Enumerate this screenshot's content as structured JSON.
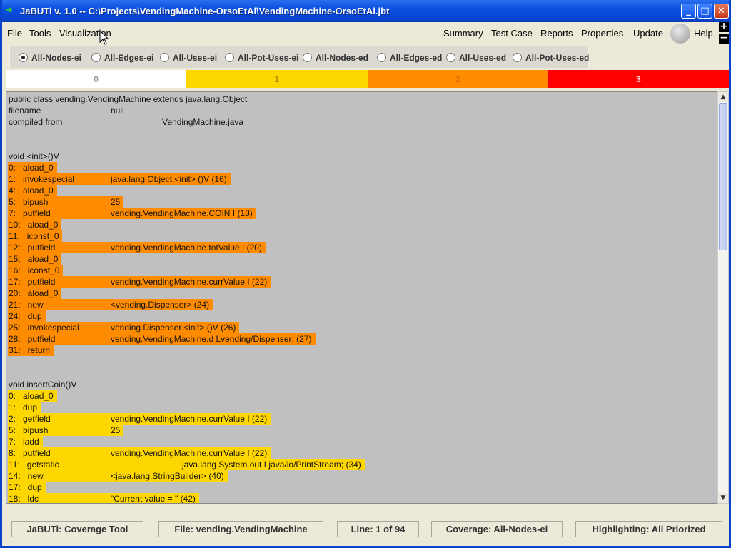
{
  "window": {
    "title": "JaBUTi v. 1.0 -- C:\\Projects\\VendingMachine-OrsoEtAl\\VendingMachine-OrsoEtAl.jbt",
    "minimize": "_",
    "maximize": "□",
    "close": "✕"
  },
  "menu": {
    "file": "File",
    "tools": "Tools",
    "visualization": "Visualization",
    "summary": "Summary",
    "test_case": "Test Case",
    "reports": "Reports",
    "properties": "Properties",
    "update": "Update",
    "help": "Help",
    "zoom_in": "+",
    "zoom_out": "−"
  },
  "criteria": [
    {
      "label": "All-Nodes-ei",
      "selected": true
    },
    {
      "label": "All-Edges-ei",
      "selected": false
    },
    {
      "label": "All-Uses-ei",
      "selected": false
    },
    {
      "label": "All-Pot-Uses-ei",
      "selected": false
    },
    {
      "label": "All-Nodes-ed",
      "selected": false
    },
    {
      "label": "All-Edges-ed",
      "selected": false
    },
    {
      "label": "All-Uses-ed",
      "selected": false
    },
    {
      "label": "All-Pot-Uses-ed",
      "selected": false
    }
  ],
  "weights": [
    {
      "label": "0",
      "bg": "#ffffff",
      "fg": "#999999"
    },
    {
      "label": "1",
      "bg": "#ffd700",
      "fg": "#b09000"
    },
    {
      "label": "2",
      "bg": "#ff8c00",
      "fg": "#e07000"
    },
    {
      "label": "3",
      "bg": "#ff0000",
      "fg": "#ffd0d0"
    }
  ],
  "code": {
    "header": [
      {
        "col1": "public class vending.VendingMachine extends java.lang.Object",
        "col2": ""
      },
      {
        "col1": "filename",
        "col2": "null"
      },
      {
        "col1": "compiled from",
        "col2": "VendingMachine.java"
      }
    ],
    "methods": [
      {
        "signature": "void <init>()V",
        "color": "#ff8c00",
        "lines": [
          {
            "op": "0:   aload_0",
            "arg": ""
          },
          {
            "op": "1:   invokespecial",
            "arg": "java.lang.Object.<init> ()V (16)"
          },
          {
            "op": "4:   aload_0",
            "arg": ""
          },
          {
            "op": "5:   bipush",
            "arg": "25"
          },
          {
            "op": "7:   putfield",
            "arg": "vending.VendingMachine.COIN I (18)"
          },
          {
            "op": "10:   aload_0",
            "arg": ""
          },
          {
            "op": "11:   iconst_0",
            "arg": ""
          },
          {
            "op": "12:   putfield",
            "arg": "vending.VendingMachine.totValue I (20)"
          },
          {
            "op": "15:   aload_0",
            "arg": ""
          },
          {
            "op": "16:   iconst_0",
            "arg": ""
          },
          {
            "op": "17:   putfield",
            "arg": "vending.VendingMachine.currValue I (22)"
          },
          {
            "op": "20:   aload_0",
            "arg": ""
          },
          {
            "op": "21:   new",
            "arg": "<vending.Dispenser> (24)"
          },
          {
            "op": "24:   dup",
            "arg": ""
          },
          {
            "op": "25:   invokespecial",
            "arg": "vending.Dispenser.<init> ()V (26)"
          },
          {
            "op": "28:   putfield",
            "arg": "vending.VendingMachine.d Lvending/Dispenser; (27)"
          },
          {
            "op": "31:   return",
            "arg": ""
          }
        ]
      },
      {
        "signature": "void insertCoin()V",
        "color": "#ffd700",
        "lines": [
          {
            "op": "0:   aload_0",
            "arg": ""
          },
          {
            "op": "1:   dup",
            "arg": ""
          },
          {
            "op": "2:   getfield",
            "arg": "vending.VendingMachine.currValue I (22)"
          },
          {
            "op": "5:   bipush",
            "arg": "25"
          },
          {
            "op": "7:   iadd",
            "arg": ""
          },
          {
            "op": "8:   putfield",
            "arg": "vending.VendingMachine.currValue I (22)"
          },
          {
            "op": "11:   getstatic",
            "arg": "java.lang.System.out Ljava/io/PrintStream; (34)"
          },
          {
            "op": "14:   new",
            "arg": "<java.lang.StringBuilder> (40)"
          },
          {
            "op": "17:   dup",
            "arg": ""
          },
          {
            "op": "18:   ldc",
            "arg": "\"Current value = \" (42)"
          }
        ]
      }
    ]
  },
  "status": {
    "app": "JaBUTi: Coverage Tool",
    "file": "File: vending.VendingMachine",
    "line": "Line: 1 of 94",
    "coverage": "Coverage: All-Nodes-ei",
    "highlighting": "Highlighting: All Priorized"
  }
}
